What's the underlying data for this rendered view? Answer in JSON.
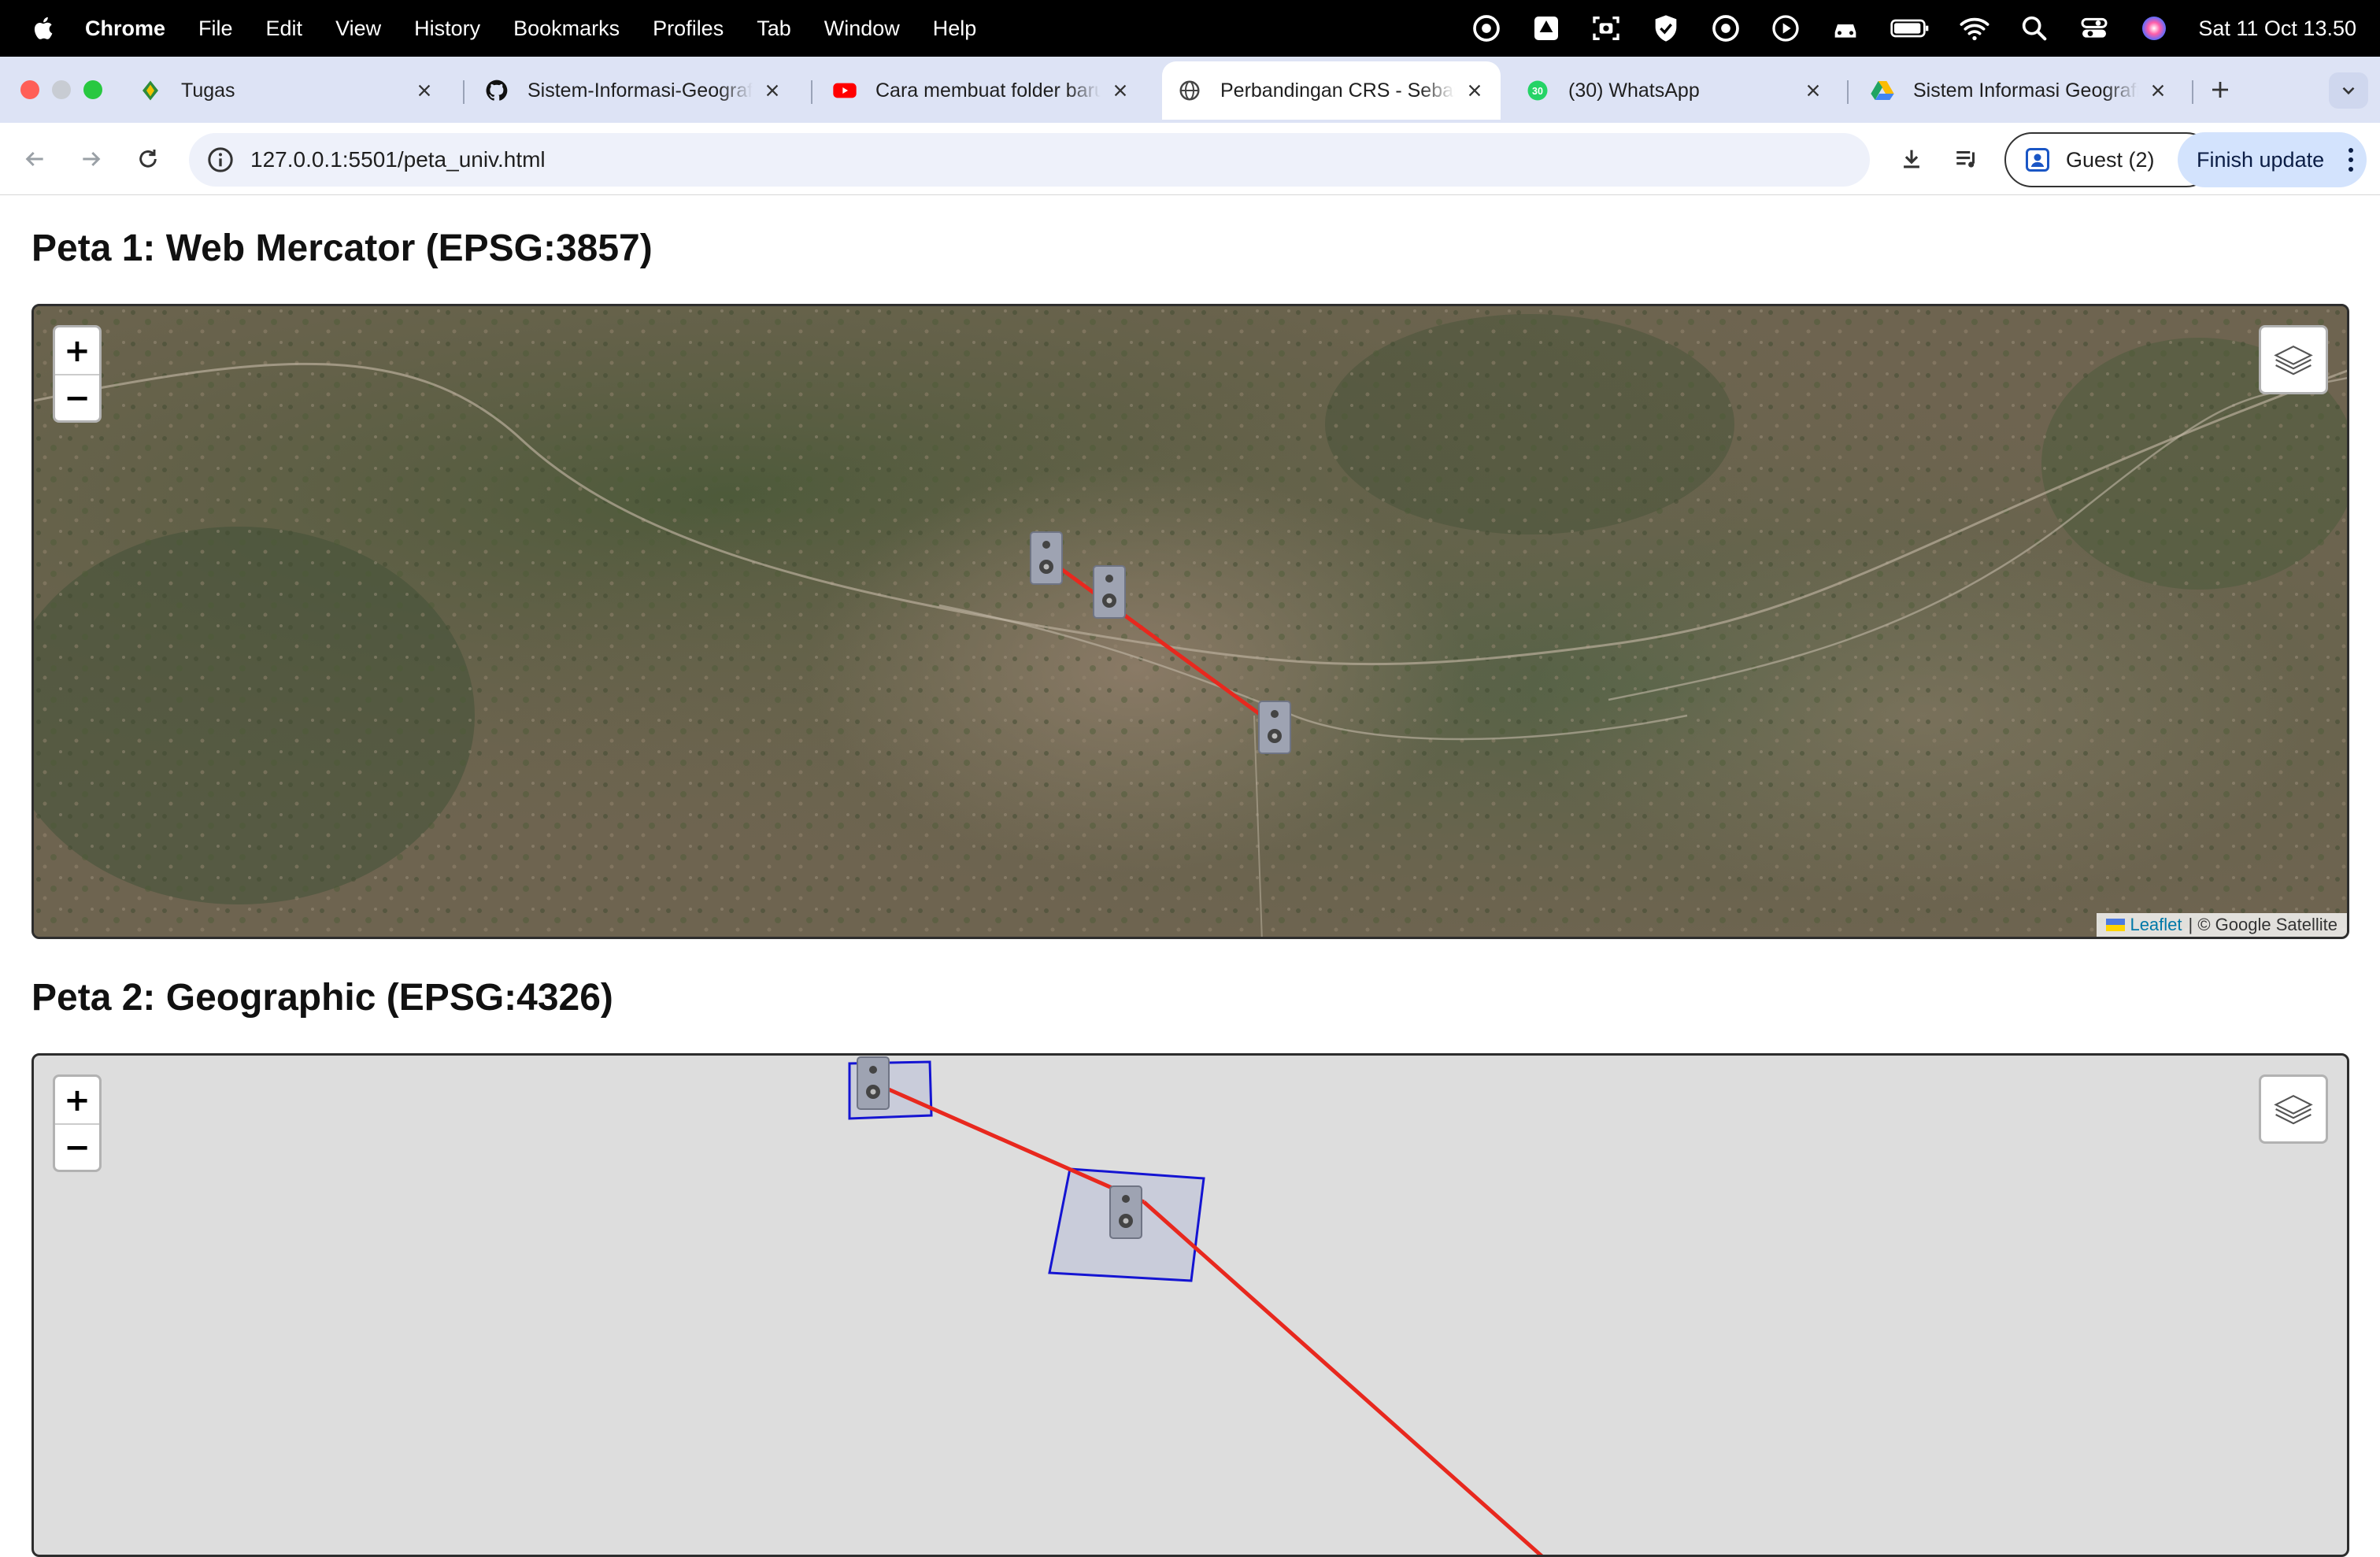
{
  "menubar": {
    "app_name": "Chrome",
    "items": [
      "File",
      "Edit",
      "View",
      "History",
      "Bookmarks",
      "Profiles",
      "Tab",
      "Window",
      "Help"
    ],
    "clock": "Sat 11 Oct  13.50",
    "status_icons": [
      "creative-cloud-icon",
      "drive-icon",
      "screenshot-icon",
      "shield-icon",
      "creative-cloud-icon",
      "play-icon",
      "car-icon",
      "battery-icon",
      "wifi-icon",
      "search-icon",
      "control-center-icon",
      "siri-icon"
    ]
  },
  "tabs": [
    {
      "title": "Tugas",
      "icon": "tugas-favicon",
      "active": false
    },
    {
      "title": "Sistem-Informasi-Geografis",
      "icon": "github-icon",
      "active": false
    },
    {
      "title": "Cara membuat folder baru",
      "icon": "youtube-icon",
      "active": false
    },
    {
      "title": "Perbandingan CRS - Sebaran",
      "icon": "globe-icon",
      "active": true
    },
    {
      "title": "(30) WhatsApp",
      "icon": "whatsapp-icon",
      "active": false
    },
    {
      "title": "Sistem Informasi Geografis",
      "icon": "google-drive-icon",
      "active": false
    }
  ],
  "toolbar": {
    "url": "127.0.0.1:5501/peta_univ.html",
    "profile_label": "Guest (2)",
    "update_label": "Finish update"
  },
  "map1": {
    "heading": "Peta 1: Web Mercator (EPSG:3857)",
    "attribution_link": "Leaflet",
    "attribution_text": "| © Google Satellite",
    "zoom_in": "+",
    "zoom_out": "−",
    "basemap": "satellite"
  },
  "map2": {
    "heading": "Peta 2: Geographic (EPSG:4326)",
    "zoom_in": "+",
    "zoom_out": "−"
  },
  "colors": {
    "route_line": "#e8281e",
    "polygon_stroke": "#1414d2",
    "map2_background": "#dddddd",
    "tab_strip": "#dde3f5",
    "accent_button": "#d3e3fd"
  }
}
